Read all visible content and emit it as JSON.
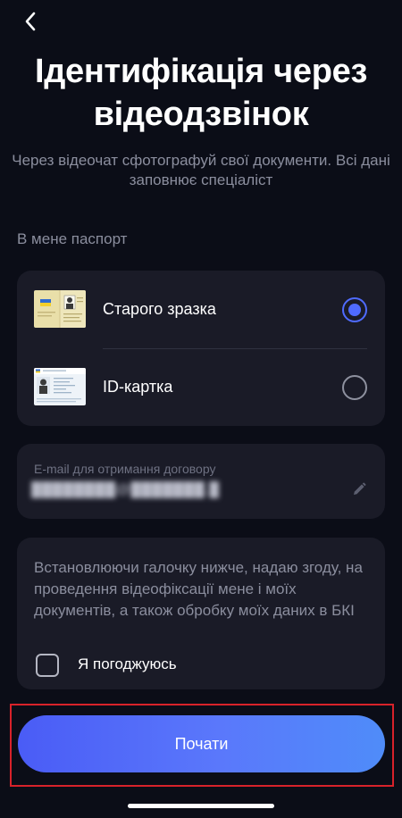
{
  "header": {
    "back_icon": "chevron-left-icon",
    "title": "Ідентифікація через відеодзвінок",
    "subtitle": "Через відеочат сфотографуй свої документи. Всі дані заповнює спеціаліст"
  },
  "passport": {
    "section_label": "В мене паспорт",
    "options": [
      {
        "label": "Старого зразка",
        "selected": true,
        "icon": "old-passport-image"
      },
      {
        "label": "ID-картка",
        "selected": false,
        "icon": "id-card-image"
      }
    ]
  },
  "email": {
    "label": "E-mail для отримання договору",
    "value": "████████@███████.███",
    "edit_icon": "pencil-icon"
  },
  "consent": {
    "text": "Встановлюючи галочку нижче, надаю згоду, на проведення відеофіксації мене і моїх документів, а також обробку моїх даних в БКІ",
    "checkbox_label": "Я погоджуюсь",
    "checked": false
  },
  "actions": {
    "start_label": "Почати"
  },
  "colors": {
    "background": "#0b0d17",
    "card": "#1a1b27",
    "accent": "#4f6bff",
    "muted_text": "#8b8e9e",
    "highlight_frame": "#d8222a"
  }
}
